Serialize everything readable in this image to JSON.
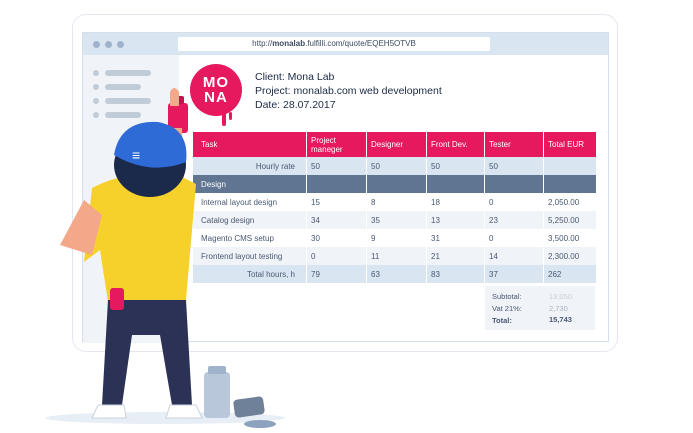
{
  "browser": {
    "url_domain": "monalab",
    "url_rest": ".fulfilli.com/quote/EQEH5OTVB",
    "url_prefix": "http://"
  },
  "logo": {
    "line1": "MO",
    "line2": "NA"
  },
  "client": {
    "client_line": "Client: Mona Lab",
    "project_line": "Project: monalab.com web development",
    "date_line": "Date: 28.07.2017"
  },
  "table": {
    "headers": [
      "Task",
      "Project maneger",
      "Designer",
      "Front Dev.",
      "Tester",
      "Total EUR"
    ],
    "hourly_rate": {
      "label": "Hourly rate",
      "values": [
        "50",
        "50",
        "50",
        "50",
        ""
      ]
    },
    "section": "Design",
    "rows": [
      {
        "task": "Internal layout design",
        "values": [
          "15",
          "8",
          "18",
          "0",
          "2,050.00"
        ]
      },
      {
        "task": "Catalog design",
        "values": [
          "34",
          "35",
          "13",
          "23",
          "5,250.00"
        ]
      },
      {
        "task": "Magento CMS setup",
        "values": [
          "30",
          "9",
          "31",
          "0",
          "3,500.00"
        ]
      },
      {
        "task": "Frontend layout testing",
        "values": [
          "0",
          "11",
          "21",
          "14",
          "2,300.00"
        ]
      }
    ],
    "total_hours": {
      "label": "Total hours, h",
      "values": [
        "79",
        "63",
        "83",
        "37",
        "262"
      ]
    }
  },
  "summary": {
    "subtotal_label": "Subtotal:",
    "subtotal_value": "13,050",
    "vat_label": "Vat 21%:",
    "vat_value": "2,730",
    "total_label": "Total:",
    "total_value": "15,743"
  },
  "colors": {
    "accent": "#e6195e",
    "section": "#5f7591",
    "light": "#d9e5f1"
  }
}
